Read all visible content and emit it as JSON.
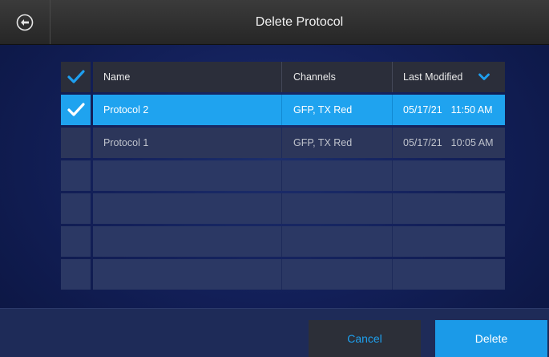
{
  "header": {
    "title": "Delete Protocol",
    "back_icon": "back-arrow-icon"
  },
  "table": {
    "columns": {
      "name": "Name",
      "channels": "Channels",
      "last_modified": "Last Modified"
    },
    "sort_icon": "chevron-down-icon",
    "select_all_checked": true,
    "rows": [
      {
        "name": "Protocol 2",
        "channels": "GFP, TX Red",
        "date": "05/17/21",
        "time": "11:50 AM",
        "checked": true
      },
      {
        "name": "Protocol 1",
        "channels": "GFP, TX Red",
        "date": "05/17/21",
        "time": "10:05 AM",
        "checked": false
      }
    ],
    "empty_rows": 4
  },
  "footer": {
    "cancel_label": "Cancel",
    "delete_label": "Delete"
  },
  "colors": {
    "accent": "#1fa3ef",
    "check": "#1e9ff0",
    "row": "#2c365a",
    "titlebar": "#2e2e2e",
    "background": "#13205a"
  }
}
